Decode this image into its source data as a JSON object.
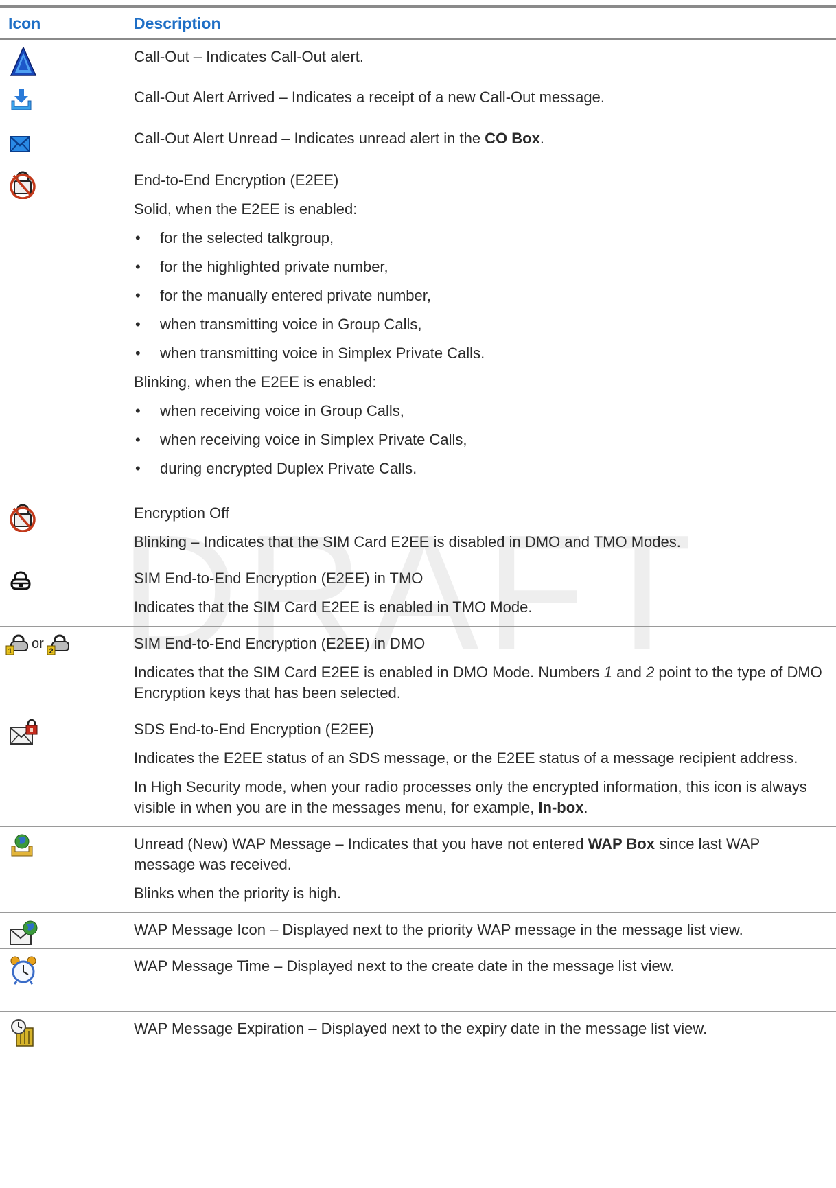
{
  "table": {
    "headers": {
      "icon": "Icon",
      "description": "Description"
    },
    "rows": [
      {
        "icon": "call-out-icon",
        "paragraphs": [
          "Call-Out – Indicates Call-Out alert."
        ]
      },
      {
        "icon": "call-out-alert-arrived-icon",
        "paragraphs": [
          "Call-Out Alert Arrived – Indicates a receipt of a new Call-Out message."
        ]
      },
      {
        "icon": "call-out-alert-unread-icon",
        "p1_prefix": "Call-Out Alert Unread – Indicates unread alert in the ",
        "p1_bold": "CO Box",
        "p1_suffix": "."
      },
      {
        "icon": "e2ee-icon",
        "p1": "End-to-End Encryption (E2EE)",
        "p2": "Solid, when the E2EE is enabled:",
        "solid_items": [
          "for the selected talkgroup,",
          "for the highlighted private number,",
          "for the manually entered private number,",
          "when transmitting voice in Group Calls,",
          "when transmitting voice in Simplex Private Calls."
        ],
        "p3": "Blinking, when the E2EE is enabled:",
        "blinking_items": [
          "when receiving voice in Group Calls,",
          "when receiving voice in Simplex Private Calls,",
          "during encrypted Duplex Private Calls."
        ]
      },
      {
        "icon": "encryption-off-icon",
        "p1": "Encryption Off",
        "p2": "Blinking – Indicates that the SIM Card E2EE is disabled in DMO and TMO Modes."
      },
      {
        "icon": "sim-e2ee-tmo-icon",
        "p1": "SIM End-to-End Encryption (E2EE) in TMO",
        "p2": "Indicates that the SIM Card E2EE is enabled in TMO Mode."
      },
      {
        "icon": "sim-e2ee-dmo-icon",
        "or_text": "or",
        "p1": "SIM End-to-End Encryption (E2EE) in DMO",
        "p2_a": "Indicates that the SIM Card E2EE is enabled in DMO Mode. Numbers ",
        "p2_num1": "1",
        "p2_b": " and ",
        "p2_num2": "2",
        "p2_c": " point to the type of DMO Encryption keys that has been selected."
      },
      {
        "icon": "sds-e2ee-icon",
        "p1": "SDS End-to-End Encryption (E2EE)",
        "p2": "Indicates the E2EE status of an SDS message, or the E2EE status of a message recipient address.",
        "p3_a": "In High Security mode, when your radio processes only the encrypted information, this icon is always visible in when you are in the messages menu, for example, ",
        "p3_bold": "In-box",
        "p3_c": "."
      },
      {
        "icon": "unread-wap-message-icon",
        "p1_a": "Unread (New) WAP Message – Indicates that you have not entered ",
        "p1_bold": "WAP Box",
        "p1_c": " since last WAP message was received.",
        "p2": "Blinks when the priority is high."
      },
      {
        "icon": "wap-message-icon",
        "p1": "WAP Message Icon – Displayed next to the priority WAP message in the message list view."
      },
      {
        "icon": "wap-message-time-icon",
        "p1": "WAP Message Time – Displayed next to the create date in the message list view."
      },
      {
        "icon": "wap-message-expiration-icon",
        "p1": "WAP Message Expiration – Displayed next to the expiry date in the message list view."
      }
    ]
  },
  "watermark": "DRAFT"
}
